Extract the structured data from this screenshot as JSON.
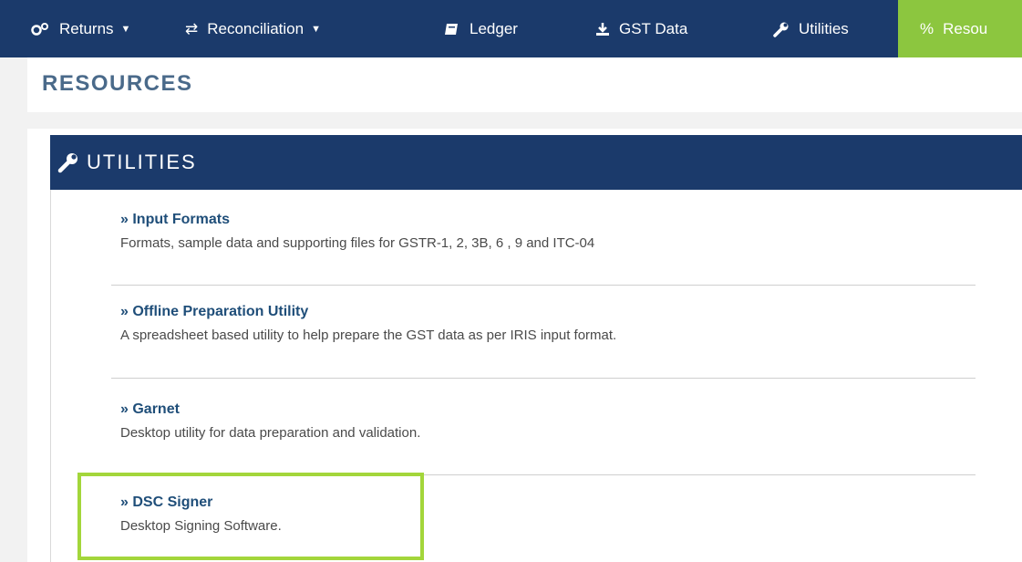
{
  "nav": {
    "items": [
      {
        "label": "Returns",
        "icon": "gears-icon",
        "dropdown": true
      },
      {
        "label": "Reconciliation",
        "icon": "swap-icon",
        "dropdown": true
      },
      {
        "label": "Ledger",
        "icon": "book-icon",
        "dropdown": false
      },
      {
        "label": "GST Data",
        "icon": "download-icon",
        "dropdown": false
      },
      {
        "label": "Utilities",
        "icon": "wrench-icon",
        "dropdown": false
      },
      {
        "label": "Resou",
        "icon": "percent-icon",
        "dropdown": false,
        "active": true
      }
    ]
  },
  "page": {
    "title": "RESOURCES"
  },
  "section": {
    "title": "UTILITIES",
    "items": [
      {
        "link": "» Input Formats",
        "desc": "Formats, sample data and supporting files for GSTR-1, 2, 3B, 6 , 9 and ITC-04"
      },
      {
        "link": "» Offline Preparation Utility",
        "desc": "A spreadsheet based utility to help prepare the GST data as per IRIS input format."
      },
      {
        "link": "» Garnet",
        "desc": "Desktop utility for data preparation and validation."
      },
      {
        "link": "» DSC Signer",
        "desc": "Desktop Signing Software."
      }
    ]
  },
  "colors": {
    "nav_bg": "#1b3a6b",
    "active_tab": "#8cc63f",
    "link": "#1f4e79",
    "highlight": "#a3d63b"
  }
}
